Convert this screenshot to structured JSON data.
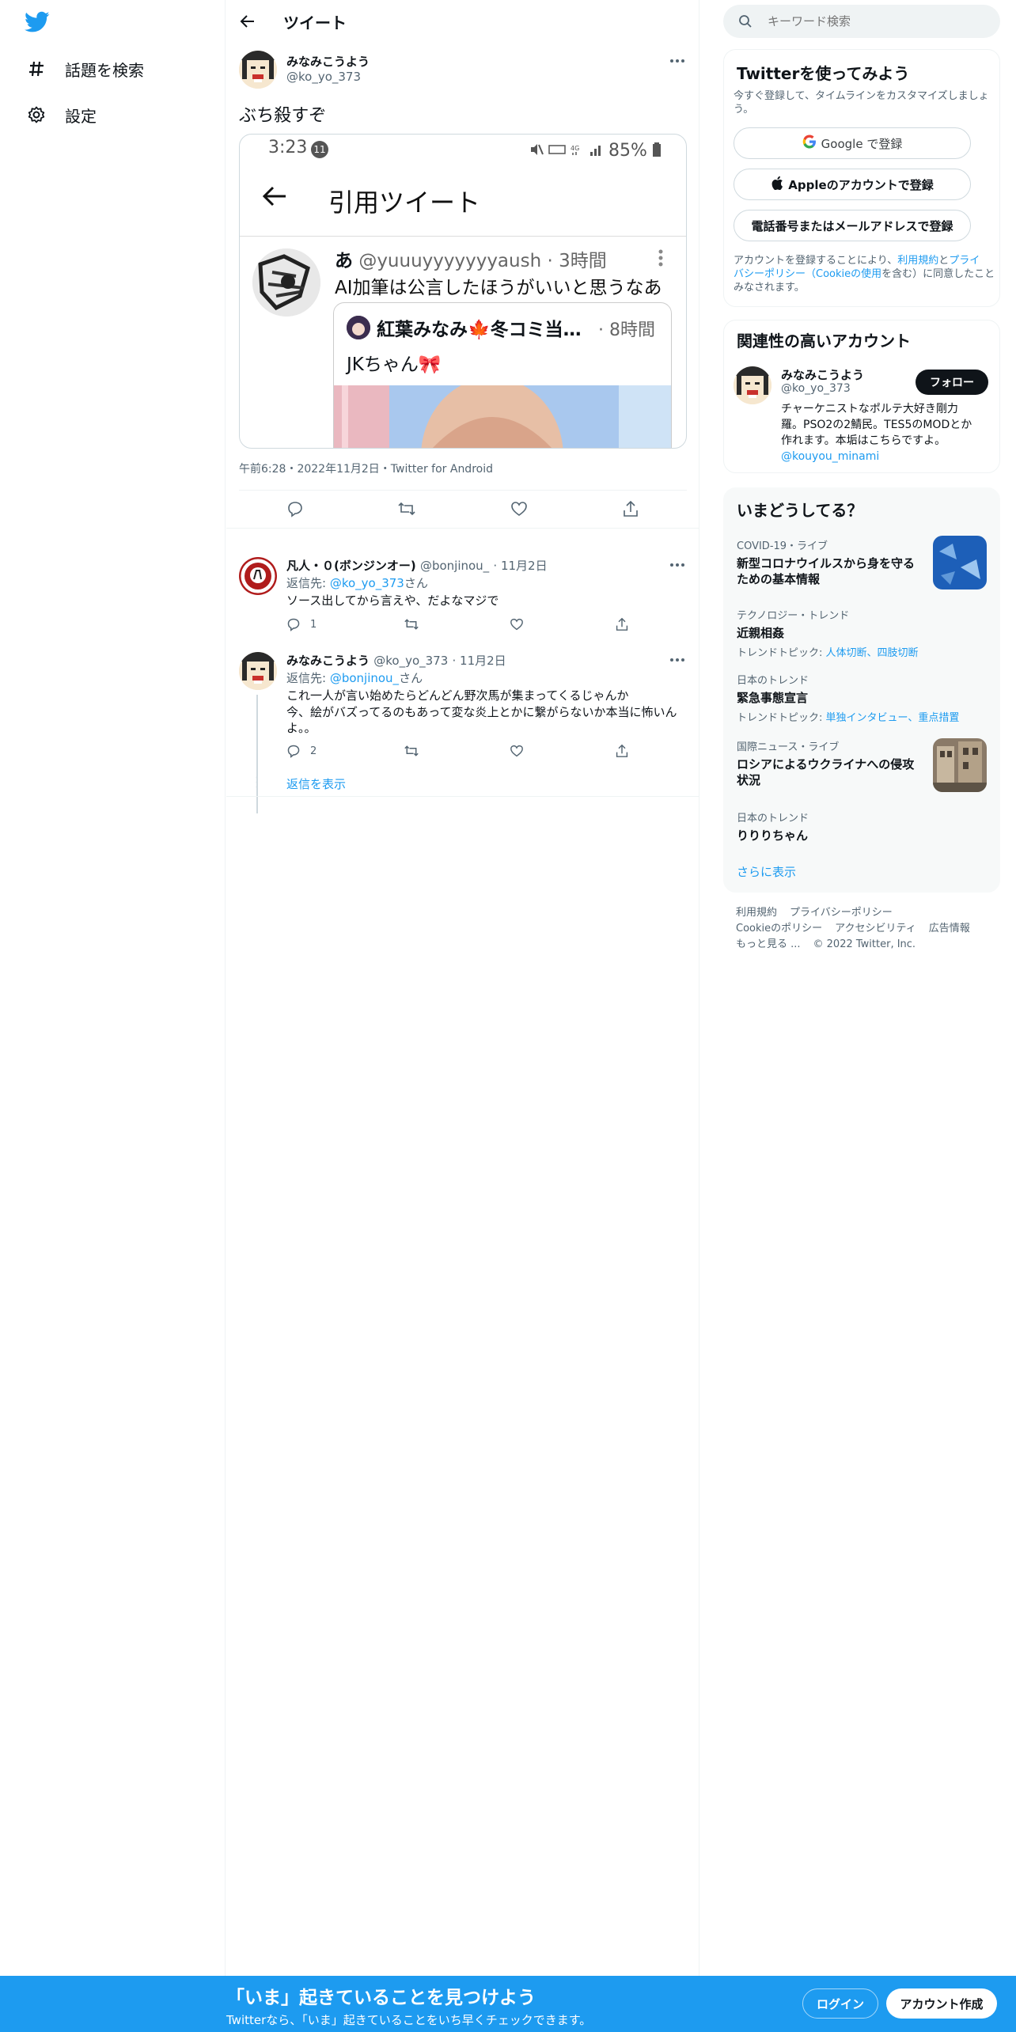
{
  "nav": {
    "logo": "twitter-bird-icon",
    "items": [
      {
        "icon": "hashtag-icon",
        "label": "話題を検索"
      },
      {
        "icon": "gear-icon",
        "label": "設定"
      }
    ]
  },
  "main": {
    "header_title": "ツイート",
    "tweet": {
      "author_name": "みなみこうよう",
      "author_handle": "@ko_yo_373",
      "text": "ぶち殺すぞ",
      "meta": "午前6:28・2022年11月2日・Twitter for Android",
      "screenshot": {
        "status_time": "3:23",
        "status_badge": "11",
        "battery": "85%",
        "screen_title": "引用ツイート",
        "quote_author": "あ",
        "quote_handle": "@yuuuyyyyyyyaush",
        "quote_time": "· 3時間",
        "quote_text": "AI加筆は公言したほうがいいと思うなあ",
        "nested_author": "紅葉みなみ🍁冬コミ当…",
        "nested_time": "· 8時間",
        "nested_text": "JKちゃん🎀"
      }
    },
    "replies": [
      {
        "name": "凡人・０(ボンジンオー)",
        "handle": "@bonjinou_",
        "date": "· 11月2日",
        "reply_to_prefix": "返信先: ",
        "reply_to": "@ko_yo_373",
        "reply_to_suffix": "さん",
        "text": "ソース出してから言えや、だよなマジで",
        "reply_count": "1"
      },
      {
        "name": "みなみこうよう",
        "handle": "@ko_yo_373",
        "date": "· 11月2日",
        "reply_to_prefix": "返信先: ",
        "reply_to": "@bonjinou_",
        "reply_to_suffix": "さん",
        "text_line1": "これ一人が言い始めたらどんどん野次馬が集まってくるじゃんか",
        "text_line2": "今、絵がバズってるのもあって変な炎上とかに繋がらないか本当に怖いん",
        "text_line3": "よ。。",
        "reply_count": "2"
      }
    ],
    "show_replies": "返信を表示"
  },
  "sidebar": {
    "search_placeholder": "キーワード検索",
    "signup_card": {
      "title": "Twitterを使ってみよう",
      "subtitle_line1": "今すぐ登録して、タイムラインをカスタマイズしましょ",
      "subtitle_line2": "う。",
      "google_btn": "Google で登録",
      "apple_btn": "Appleのアカウントで登録",
      "phone_btn": "電話番号またはメールアドレスで登録",
      "legal_line1_a": "アカウントを登録することにより、",
      "legal_line1_b": "利用規約",
      "legal_line1_c": "と",
      "legal_line1_d": "プライ",
      "legal_line2_a": "バシーポリシー",
      "legal_line2_b": "（",
      "legal_line2_c": "Cookieの使用",
      "legal_line2_d": "を含む）に同意したこと",
      "legal_line3": "みなされます。"
    },
    "related_card": {
      "title": "関連性の高いアカウント",
      "name": "みなみこうよう",
      "handle": "@ko_yo_373",
      "follow_btn": "フォロー",
      "bio_line1": "チャーケニストなポルテ大好き剛力",
      "bio_line2": "羅。PSO2の2鯖民。TES5のMODとか",
      "bio_line3": "作れます。本垢はこちらですよ。",
      "bio_link": "@kouyou_minami"
    },
    "trends_card": {
      "title": "いまどうしてる？",
      "trends": [
        {
          "context": "COVID-19・ライブ",
          "title_line1": "新型コロナウイルスから身を守る",
          "title_line2": "ための基本情報"
        },
        {
          "context": "テクノロジー・トレンド",
          "title_line1": "近親相姦",
          "topic_prefix": "トレンドトピック: ",
          "topics": "人体切断、四肢切断"
        },
        {
          "context": "日本のトレンド",
          "title_line1": "緊急事態宣言",
          "topic_prefix": "トレンドトピック: ",
          "topics": "単独インタビュー、重点措置"
        },
        {
          "context": "国際ニュース・ライブ",
          "title_line1": "ロシアによるウクライナへの侵攻",
          "title_line2": "状況"
        },
        {
          "context": "日本のトレンド",
          "title_line1": "りりりちゃん"
        }
      ],
      "show_more": "さらに表示"
    },
    "footer": {
      "line1": [
        "利用規約",
        "プライバシーポリシー"
      ],
      "line2": [
        "Cookieのポリシー",
        "アクセシビリティ",
        "広告情報"
      ],
      "more": "もっと見る ...",
      "copyright": "© 2022 Twitter, Inc."
    }
  },
  "bottom_bar": {
    "headline": "「いま」起きていることを見つけよう",
    "subline": "Twitterなら、「いま」起きていることをいち早くチェックできます。",
    "login": "ログイン",
    "signup": "アカウント作成"
  },
  "colors": {
    "accent": "#1d9bf0",
    "text": "#0f1419",
    "muted": "#536471"
  }
}
